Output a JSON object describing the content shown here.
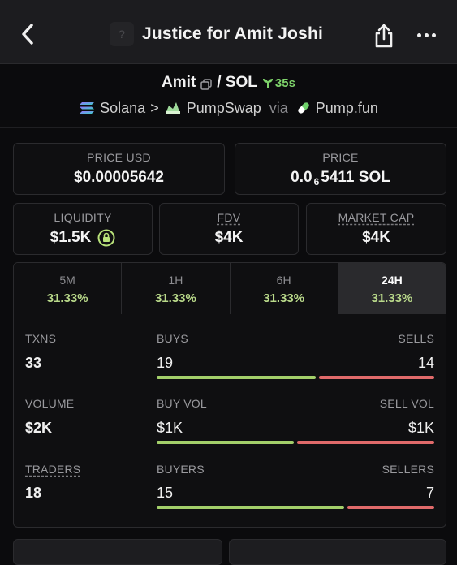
{
  "header": {
    "title": "Justice for Amit Joshi",
    "thumb_glyph": "?"
  },
  "pair": {
    "base": "Amit",
    "quote": "/ SOL",
    "age": "35s",
    "chain": "Solana",
    "separator": ">",
    "dex": "PumpSwap",
    "via_label": "via",
    "launchpad": "Pump.fun"
  },
  "price_usd": {
    "label": "PRICE USD",
    "value": "$0.00005642"
  },
  "price_native": {
    "label": "PRICE",
    "prefix": "0.0",
    "zeros": "6",
    "digits": "5411",
    "unit": "SOL"
  },
  "liquidity": {
    "label": "LIQUIDITY",
    "value": "$1.5K"
  },
  "fdv": {
    "label": "FDV",
    "value": "$4K"
  },
  "market_cap": {
    "label": "MARKET CAP",
    "value": "$4K"
  },
  "periods": [
    {
      "label": "5M",
      "change": "31.33%"
    },
    {
      "label": "1H",
      "change": "31.33%"
    },
    {
      "label": "6H",
      "change": "31.33%"
    },
    {
      "label": "24H",
      "change": "31.33%",
      "active": true
    }
  ],
  "stats": {
    "txns": {
      "label": "TXNS",
      "value": "33"
    },
    "buys": {
      "label": "BUYS",
      "value": "19",
      "fraction": 0.58
    },
    "sells": {
      "label": "SELLS",
      "value": "14"
    },
    "volume": {
      "label": "VOLUME",
      "value": "$2K"
    },
    "buy_vol": {
      "label": "BUY VOL",
      "value": "$1K",
      "fraction": 0.5
    },
    "sell_vol": {
      "label": "SELL VOL",
      "value": "$1K"
    },
    "traders": {
      "label": "TRADERS",
      "value": "18"
    },
    "buyers": {
      "label": "BUYERS",
      "value": "15",
      "fraction": 0.68
    },
    "sellers": {
      "label": "SELLERS",
      "value": "7"
    }
  },
  "colors": {
    "positive": "#a3cf6a",
    "negative": "#e06a6a",
    "age_green": "#7fd46b",
    "background": "#0b0b0d"
  }
}
